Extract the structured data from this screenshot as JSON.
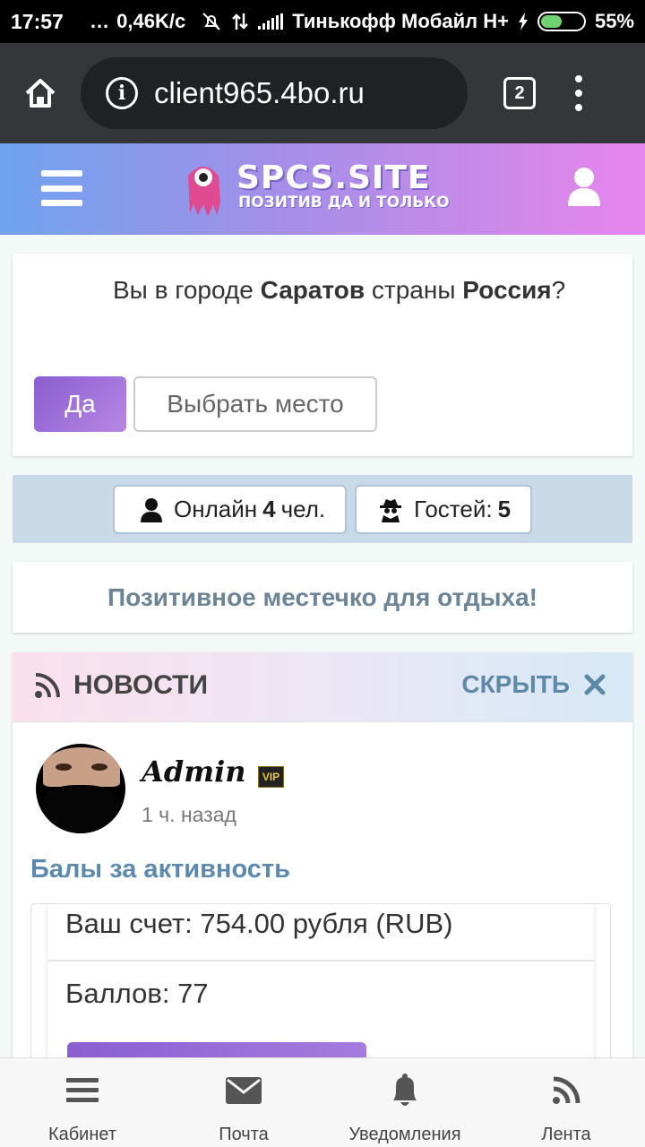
{
  "status_bar": {
    "time": "17:57",
    "dots": "...",
    "speed": "0,46K/c",
    "carrier": "Тинькофф Мобайл H+",
    "battery": "55%",
    "battery_level": 0.55
  },
  "browser": {
    "url": "client965.4bo.ru",
    "tabs_count": "2"
  },
  "site": {
    "logo_title": "SPCS.SITE",
    "logo_subtitle": "ПОЗИТИВ ДА И ТОЛЬКО"
  },
  "city_prompt": {
    "text_before": "Вы в городе ",
    "city": "Саратов",
    "text_middle": " страны ",
    "country": "Россия",
    "text_after": "?",
    "yes_label": "Да",
    "choose_label": "Выбрать место"
  },
  "online": {
    "online_prefix": "Онлайн",
    "online_count": "4",
    "online_suffix": "чел.",
    "guests_label": "Гостей:",
    "guests_count": "5"
  },
  "slogan": "Позитивное местечко для отдыха!",
  "news": {
    "title": "НОВОСТИ",
    "hide_label": "СКРЫТЬ",
    "post": {
      "author": "Admin",
      "badge": "VIP",
      "time": "1 ч. назад",
      "title": "Балы за активность",
      "line1": "Ваш счет: 754.00 рубля (RUB)",
      "line2": "Баллов: 77"
    }
  },
  "bottom_nav": {
    "cabinet": "Кабинет",
    "mail": "Почта",
    "notifications": "Уведомления",
    "feed": "Лента"
  },
  "icons": [
    "home-icon",
    "info-icon",
    "menu-dots-icon",
    "hamburger-icon",
    "user-icon",
    "spy-icon",
    "rss-icon",
    "close-icon",
    "mail-icon",
    "bell-icon"
  ],
  "colors": {
    "accent_purple": "#8a5ed0",
    "link_blue": "#5b8aae",
    "header_gradient_start": "#6fa3ee",
    "header_gradient_end": "#e885ee"
  }
}
